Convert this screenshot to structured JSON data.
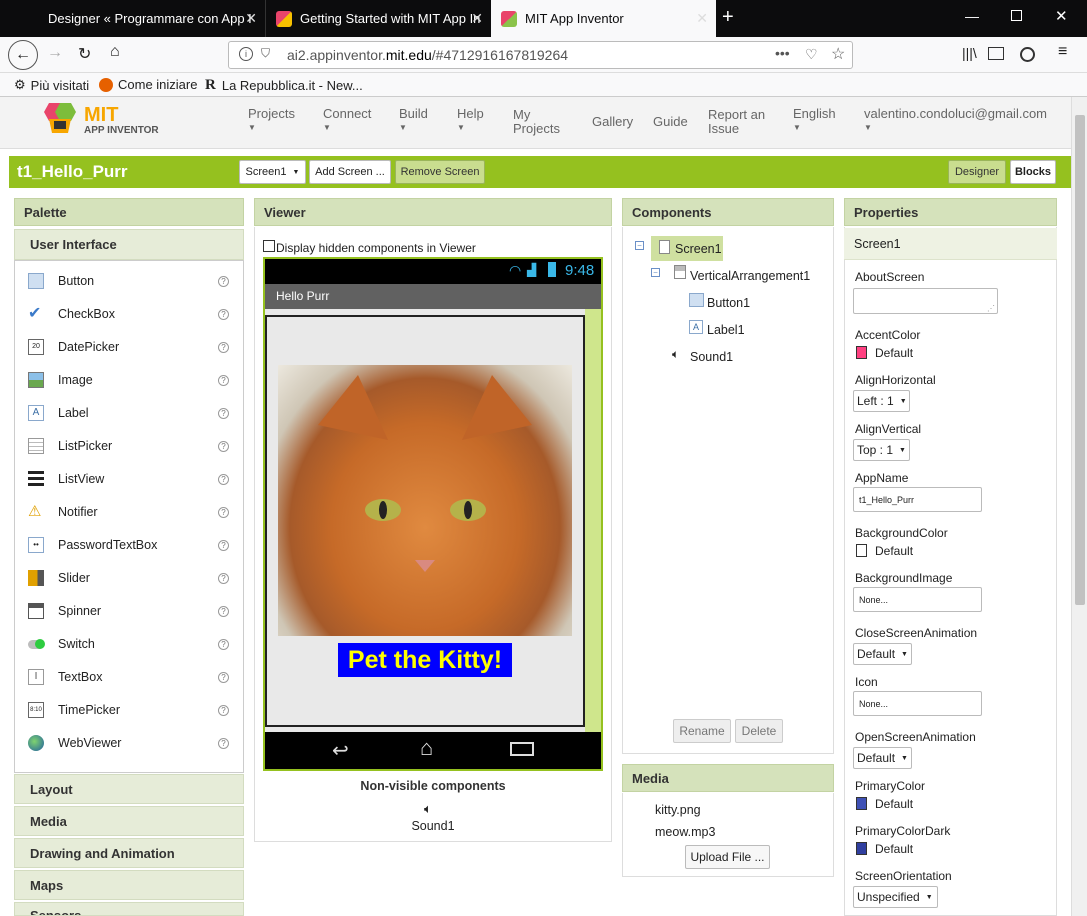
{
  "browser": {
    "tabs": [
      {
        "label": "Designer « Programmare con App I"
      },
      {
        "label": "Getting Started with MIT App In"
      },
      {
        "label": "MIT App Inventor"
      }
    ],
    "url_prefix": "ai2.appinventor.",
    "url_domain": "mit.edu",
    "url_rest": "/#4712916167819264",
    "bookmarks": [
      "Più visitati",
      "Come iniziare",
      "La Repubblica.it - New..."
    ]
  },
  "app": {
    "logo_top": "MIT",
    "logo_bottom": "APP INVENTOR",
    "menu": [
      "Projects",
      "Connect",
      "Build",
      "Help",
      "My Projects",
      "Gallery",
      "Guide",
      "Report an Issue",
      "English"
    ],
    "user": "valentino.condoluci@gmail.com"
  },
  "project": {
    "name": "t1_Hello_Purr",
    "screen_select": "Screen1",
    "add_screen": "Add Screen ...",
    "remove_screen": "Remove Screen",
    "designer": "Designer",
    "blocks": "Blocks"
  },
  "palette": {
    "title": "Palette",
    "active_category": "User Interface",
    "items": [
      "Button",
      "CheckBox",
      "DatePicker",
      "Image",
      "Label",
      "ListPicker",
      "ListView",
      "Notifier",
      "PasswordTextBox",
      "Slider",
      "Spinner",
      "Switch",
      "TextBox",
      "TimePicker",
      "WebViewer"
    ],
    "categories": [
      "Layout",
      "Media",
      "Drawing and Animation",
      "Maps",
      "Sensors"
    ]
  },
  "viewer": {
    "title": "Viewer",
    "hidden_label": "Display hidden components in Viewer",
    "time": "9:48",
    "app_title": "Hello Purr",
    "label_text": "Pet the Kitty!",
    "nonvisible_title": "Non-visible components",
    "nonvisible_item": "Sound1"
  },
  "components": {
    "title": "Components",
    "tree": [
      "Screen1",
      "VerticalArrangement1",
      "Button1",
      "Label1",
      "Sound1"
    ],
    "rename": "Rename",
    "delete": "Delete"
  },
  "media": {
    "title": "Media",
    "files": [
      "kitty.png",
      "meow.mp3"
    ],
    "upload": "Upload File ..."
  },
  "properties": {
    "title": "Properties",
    "component": "Screen1",
    "about": "AboutScreen",
    "accent": "AccentColor",
    "accent_val": "Default",
    "alignh": "AlignHorizontal",
    "alignh_val": "Left : 1",
    "alignv": "AlignVertical",
    "alignv_val": "Top : 1",
    "appname": "AppName",
    "appname_val": "t1_Hello_Purr",
    "bgcolor": "BackgroundColor",
    "bgcolor_val": "Default",
    "bgimage": "BackgroundImage",
    "bgimage_val": "None...",
    "closeanim": "CloseScreenAnimation",
    "closeanim_val": "Default",
    "icon": "Icon",
    "icon_val": "None...",
    "openanim": "OpenScreenAnimation",
    "openanim_val": "Default",
    "primary": "PrimaryColor",
    "primary_val": "Default",
    "primarydark": "PrimaryColorDark",
    "primarydark_val": "Default",
    "orientation": "ScreenOrientation",
    "orientation_val": "Unspecified"
  },
  "colors": {
    "accent": "#ff4081",
    "primary": "#3f51b5",
    "primarydark": "#303f9f",
    "green": "#95c11f",
    "label_bg": "#0000ff",
    "label_fg": "#ffff00"
  }
}
